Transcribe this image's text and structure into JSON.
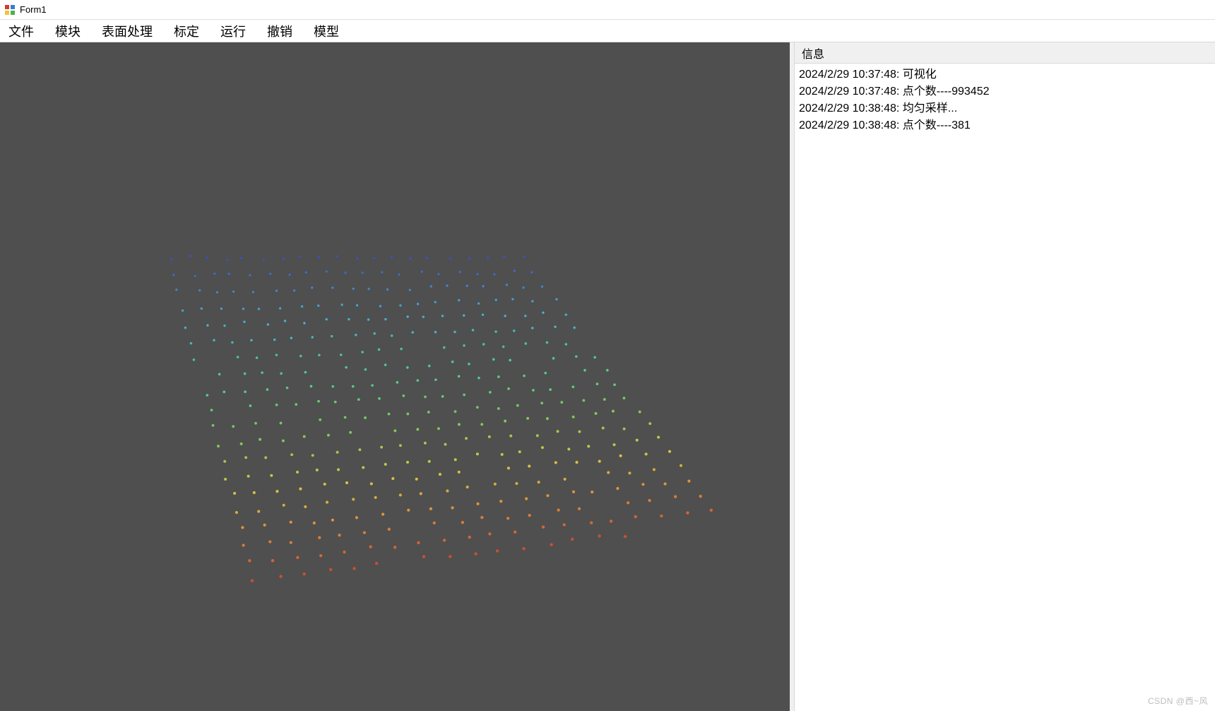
{
  "window": {
    "title": "Form1"
  },
  "menu": {
    "items": [
      "文件",
      "模块",
      "表面处理",
      "标定",
      "运行",
      "撤销",
      "模型"
    ]
  },
  "info_panel": {
    "header": "信息",
    "logs": [
      "2024/2/29 10:37:48: 可视化",
      "2024/2/29 10:37:48: 点个数----993452",
      "2024/2/29 10:38:48: 均匀采样...",
      "2024/2/29 10:38:48: 点个数----381"
    ]
  },
  "viewport": {
    "background": "#4f4f4f",
    "point_count": 381
  },
  "watermark": "CSDN @西~风"
}
